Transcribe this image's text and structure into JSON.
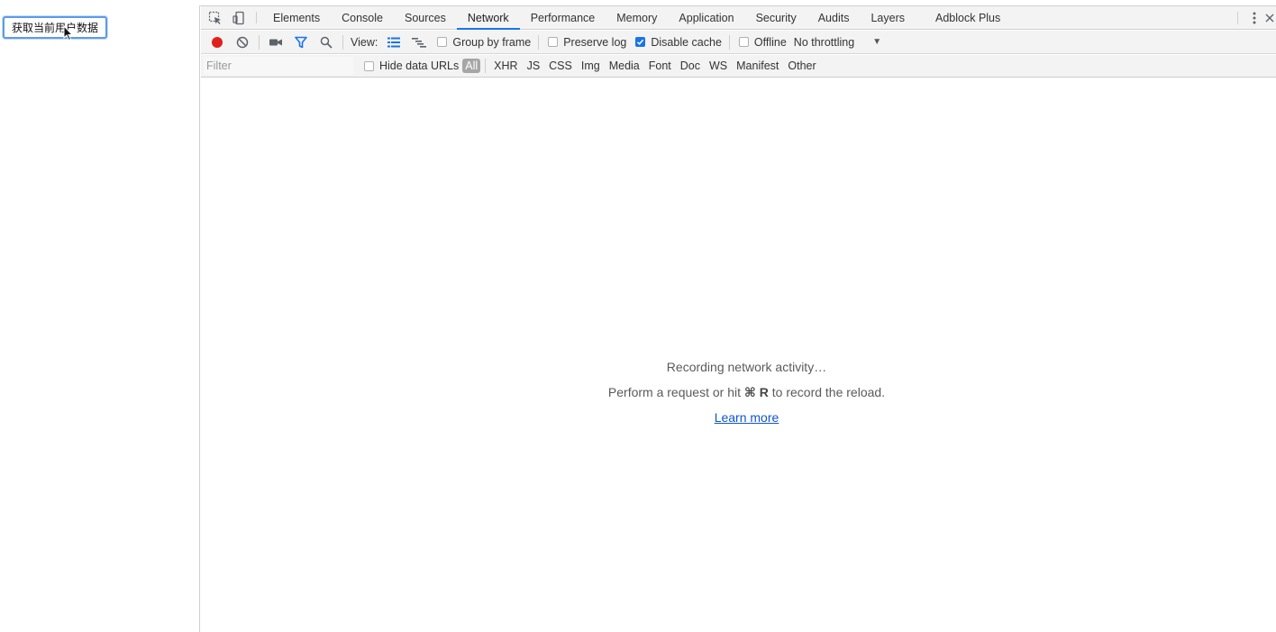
{
  "page": {
    "button_label": "获取当前用户数据"
  },
  "devtools": {
    "tabs": [
      {
        "label": "Elements"
      },
      {
        "label": "Console"
      },
      {
        "label": "Sources"
      },
      {
        "label": "Network",
        "active": true
      },
      {
        "label": "Performance"
      },
      {
        "label": "Memory"
      },
      {
        "label": "Application"
      },
      {
        "label": "Security"
      },
      {
        "label": "Audits"
      },
      {
        "label": "Layers"
      },
      {
        "label": "Adblock Plus"
      }
    ],
    "toolbar": {
      "view_label": "View:",
      "group_by_frame": {
        "label": "Group by frame",
        "checked": false
      },
      "preserve_log": {
        "label": "Preserve log",
        "checked": false
      },
      "disable_cache": {
        "label": "Disable cache",
        "checked": true
      },
      "offline": {
        "label": "Offline",
        "checked": false
      },
      "throttling": "No throttling"
    },
    "filterbar": {
      "placeholder": "Filter",
      "hide_data_urls": {
        "label": "Hide data URLs",
        "checked": false
      },
      "types": [
        "All",
        "XHR",
        "JS",
        "CSS",
        "Img",
        "Media",
        "Font",
        "Doc",
        "WS",
        "Manifest",
        "Other"
      ]
    },
    "empty_state": {
      "line1": "Recording network activity…",
      "line2_prefix": "Perform a request or hit ",
      "line2_key": "⌘ R",
      "line2_suffix": " to record the reload.",
      "link": "Learn more"
    },
    "colors": {
      "accent": "#1a73e8",
      "record": "#e0201d"
    }
  }
}
